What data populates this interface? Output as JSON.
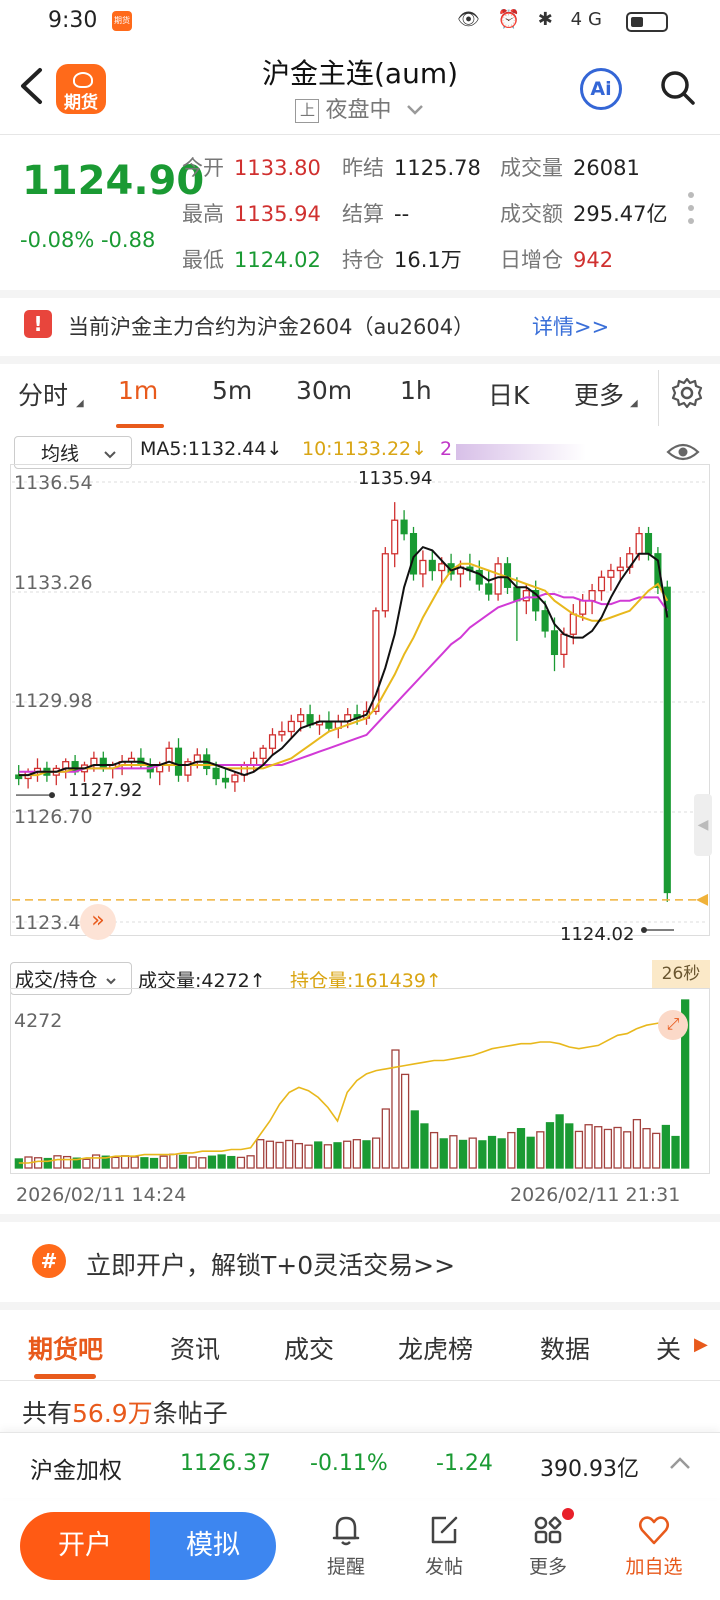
{
  "status": {
    "time": "9:30",
    "app_badge": "期货",
    "icons": "👁 ⏰ ✱ 4G"
  },
  "header": {
    "logo_text": "期货",
    "title": "沪金主连(aum)",
    "session_box": "上",
    "session_label": "夜盘中",
    "ai_label": "Ai"
  },
  "quote": {
    "last": "1124.90",
    "change_pct": "-0.08%",
    "change_abs": "-0.88",
    "open": {
      "label": "今开",
      "value": "1133.80"
    },
    "prev_close": {
      "label": "昨结",
      "value": "1125.78"
    },
    "volume": {
      "label": "成交量",
      "value": "26081"
    },
    "high": {
      "label": "最高",
      "value": "1135.94"
    },
    "settle": {
      "label": "结算",
      "value": "--"
    },
    "turnover": {
      "label": "成交额",
      "value": "295.47亿"
    },
    "low": {
      "label": "最低",
      "value": "1124.02"
    },
    "open_interest": {
      "label": "持仓",
      "value": "16.1万"
    },
    "oi_change": {
      "label": "日增仓",
      "value": "942"
    }
  },
  "notice": {
    "icon": "!",
    "text": "当前沪金主力合约为沪金2604（au2604）",
    "link": "详情>>"
  },
  "timeframes": [
    "分时",
    "1m",
    "5m",
    "30m",
    "1h",
    "日K",
    "更多"
  ],
  "indicators": {
    "select": "均线",
    "ma5": "MA5:1132.44↓",
    "ma10": "10:1133.22↓",
    "ma20": "2",
    "volume_select": "成交/持仓",
    "volume_text": "成交量:4272↑",
    "oi_text": "持仓量:161439↑",
    "countdown": "26秒"
  },
  "chart_data": {
    "type": "candlestick",
    "y_ticks": [
      "1136.54",
      "1133.26",
      "1129.98",
      "1126.70",
      "1123.42"
    ],
    "ylim": [
      1123.42,
      1136.54
    ],
    "annotations": {
      "high": "1135.94",
      "left_low": "1127.92",
      "right_low": "1124.02"
    },
    "candles": [
      [
        1127.8,
        1128.1,
        1127.5,
        1127.7
      ],
      [
        1127.7,
        1128.0,
        1127.4,
        1127.9
      ],
      [
        1127.9,
        1128.3,
        1127.6,
        1128.0
      ],
      [
        1128.0,
        1128.2,
        1127.6,
        1127.8
      ],
      [
        1127.8,
        1128.1,
        1127.5,
        1128.0
      ],
      [
        1128.0,
        1128.3,
        1127.7,
        1128.2
      ],
      [
        1128.2,
        1128.4,
        1127.8,
        1127.9
      ],
      [
        1127.9,
        1128.2,
        1127.6,
        1128.1
      ],
      [
        1128.1,
        1128.5,
        1127.9,
        1128.3
      ],
      [
        1128.3,
        1128.5,
        1127.9,
        1128.0
      ],
      [
        1128.0,
        1128.2,
        1127.7,
        1128.1
      ],
      [
        1128.1,
        1128.4,
        1127.8,
        1128.2
      ],
      [
        1128.2,
        1128.5,
        1128.0,
        1128.3
      ],
      [
        1128.3,
        1128.6,
        1128.0,
        1128.1
      ],
      [
        1128.1,
        1128.3,
        1127.7,
        1127.9
      ],
      [
        1127.9,
        1128.2,
        1127.5,
        1128.1
      ],
      [
        1128.1,
        1128.8,
        1127.9,
        1128.6
      ],
      [
        1128.6,
        1128.9,
        1127.6,
        1127.8
      ],
      [
        1127.8,
        1128.3,
        1127.6,
        1128.2
      ],
      [
        1128.2,
        1128.6,
        1128.0,
        1128.4
      ],
      [
        1128.4,
        1128.6,
        1127.8,
        1128.0
      ],
      [
        1128.0,
        1128.2,
        1127.5,
        1127.7
      ],
      [
        1127.7,
        1128.0,
        1127.4,
        1127.6
      ],
      [
        1127.6,
        1127.9,
        1127.3,
        1127.8
      ],
      [
        1127.8,
        1128.2,
        1127.6,
        1128.1
      ],
      [
        1128.1,
        1128.5,
        1127.9,
        1128.3
      ],
      [
        1128.3,
        1128.7,
        1128.1,
        1128.6
      ],
      [
        1128.6,
        1129.2,
        1128.4,
        1129.0
      ],
      [
        1129.0,
        1129.4,
        1128.8,
        1129.1
      ],
      [
        1129.1,
        1129.6,
        1128.9,
        1129.4
      ],
      [
        1129.4,
        1129.8,
        1129.1,
        1129.6
      ],
      [
        1129.6,
        1129.9,
        1129.2,
        1129.3
      ],
      [
        1129.3,
        1129.6,
        1129.0,
        1129.4
      ],
      [
        1129.4,
        1129.7,
        1129.1,
        1129.2
      ],
      [
        1129.2,
        1129.6,
        1128.9,
        1129.4
      ],
      [
        1129.4,
        1129.8,
        1129.2,
        1129.6
      ],
      [
        1129.6,
        1129.9,
        1129.3,
        1129.5
      ],
      [
        1129.5,
        1130.0,
        1129.3,
        1129.7
      ],
      [
        1129.7,
        1132.8,
        1129.6,
        1132.7
      ],
      [
        1132.7,
        1134.6,
        1132.5,
        1134.4
      ],
      [
        1134.4,
        1135.94,
        1134.0,
        1135.4
      ],
      [
        1135.4,
        1135.7,
        1134.8,
        1135.0
      ],
      [
        1135.0,
        1135.2,
        1133.6,
        1133.8
      ],
      [
        1133.8,
        1134.5,
        1133.4,
        1134.2
      ],
      [
        1134.2,
        1134.5,
        1133.6,
        1133.9
      ],
      [
        1133.9,
        1134.3,
        1133.5,
        1134.1
      ],
      [
        1134.1,
        1134.4,
        1133.6,
        1133.8
      ],
      [
        1133.8,
        1134.2,
        1133.4,
        1134.0
      ],
      [
        1134.0,
        1134.4,
        1133.6,
        1133.9
      ],
      [
        1133.9,
        1134.2,
        1133.3,
        1133.5
      ],
      [
        1133.5,
        1133.9,
        1133.0,
        1133.2
      ],
      [
        1133.2,
        1134.3,
        1133.0,
        1134.1
      ],
      [
        1134.1,
        1134.3,
        1133.2,
        1133.4
      ],
      [
        1133.4,
        1133.7,
        1131.8,
        1133.0
      ],
      [
        1133.0,
        1133.5,
        1132.6,
        1133.3
      ],
      [
        1133.3,
        1133.6,
        1132.4,
        1132.7
      ],
      [
        1132.7,
        1133.0,
        1131.9,
        1132.1
      ],
      [
        1132.1,
        1132.5,
        1130.9,
        1131.4
      ],
      [
        1131.4,
        1132.2,
        1131.0,
        1132.0
      ],
      [
        1132.0,
        1132.9,
        1131.7,
        1132.6
      ],
      [
        1132.6,
        1133.2,
        1132.4,
        1133.0
      ],
      [
        1133.0,
        1133.5,
        1132.6,
        1133.3
      ],
      [
        1133.3,
        1133.9,
        1133.0,
        1133.7
      ],
      [
        1133.7,
        1134.1,
        1133.3,
        1133.9
      ],
      [
        1133.9,
        1134.3,
        1133.6,
        1134.0
      ],
      [
        1134.0,
        1134.6,
        1133.8,
        1134.4
      ],
      [
        1134.4,
        1135.2,
        1134.2,
        1135.0
      ],
      [
        1135.0,
        1135.2,
        1134.2,
        1134.4
      ],
      [
        1134.4,
        1134.6,
        1133.2,
        1133.4
      ],
      [
        1133.4,
        1133.6,
        1124.02,
        1124.3
      ]
    ],
    "ma5": [
      1127.8,
      1127.8,
      1127.9,
      1127.9,
      1127.9,
      1128.0,
      1128.0,
      1128.0,
      1128.1,
      1128.1,
      1128.1,
      1128.2,
      1128.2,
      1128.2,
      1128.1,
      1128.1,
      1128.2,
      1128.1,
      1128.1,
      1128.2,
      1128.2,
      1128.1,
      1128.0,
      1127.9,
      1127.8,
      1127.9,
      1128.1,
      1128.4,
      1128.6,
      1128.9,
      1129.2,
      1129.3,
      1129.4,
      1129.4,
      1129.4,
      1129.4,
      1129.5,
      1129.6,
      1130.2,
      1131.0,
      1132.0,
      1133.4,
      1134.3,
      1134.6,
      1134.5,
      1134.2,
      1133.9,
      1134.0,
      1133.9,
      1133.8,
      1133.6,
      1133.7,
      1133.7,
      1133.4,
      1133.4,
      1133.2,
      1132.9,
      1132.3,
      1132.0,
      1131.9,
      1131.9,
      1132.1,
      1132.5,
      1133.1,
      1133.6,
      1134.0,
      1134.4,
      1134.4,
      1134.2,
      1132.5
    ],
    "ma10": [
      1127.8,
      1127.8,
      1127.8,
      1127.9,
      1127.9,
      1127.9,
      1128.0,
      1128.0,
      1128.0,
      1128.0,
      1128.0,
      1128.1,
      1128.1,
      1128.1,
      1128.1,
      1128.1,
      1128.1,
      1128.1,
      1128.1,
      1128.1,
      1128.1,
      1128.1,
      1128.0,
      1128.0,
      1128.0,
      1128.0,
      1128.0,
      1128.1,
      1128.2,
      1128.3,
      1128.5,
      1128.7,
      1128.9,
      1129.1,
      1129.2,
      1129.3,
      1129.4,
      1129.5,
      1129.8,
      1130.3,
      1130.8,
      1131.4,
      1131.9,
      1132.5,
      1133.0,
      1133.5,
      1133.9,
      1134.1,
      1134.1,
      1134.0,
      1133.9,
      1133.8,
      1133.7,
      1133.6,
      1133.5,
      1133.4,
      1133.3,
      1133.0,
      1132.8,
      1132.6,
      1132.5,
      1132.4,
      1132.4,
      1132.5,
      1132.6,
      1132.7,
      1133.0,
      1133.3,
      1133.5,
      1133.0
    ],
    "ma20": [
      1127.9,
      1127.9,
      1127.9,
      1127.9,
      1127.9,
      1127.9,
      1127.9,
      1128.0,
      1128.0,
      1128.0,
      1128.0,
      1128.0,
      1128.0,
      1128.0,
      1128.0,
      1128.1,
      1128.1,
      1128.1,
      1128.1,
      1128.1,
      1128.1,
      1128.1,
      1128.1,
      1128.1,
      1128.1,
      1128.1,
      1128.1,
      1128.1,
      1128.1,
      1128.2,
      1128.3,
      1128.4,
      1128.5,
      1128.6,
      1128.7,
      1128.8,
      1128.9,
      1129.0,
      1129.3,
      1129.6,
      1129.9,
      1130.2,
      1130.5,
      1130.8,
      1131.1,
      1131.4,
      1131.7,
      1131.9,
      1132.2,
      1132.4,
      1132.6,
      1132.8,
      1132.9,
      1133.0,
      1133.1,
      1133.1,
      1133.2,
      1133.2,
      1133.1,
      1133.1,
      1133.0,
      1133.0,
      1132.9,
      1132.9,
      1133.0,
      1133.0,
      1133.1,
      1133.1,
      1133.1,
      1132.7
    ],
    "volume_max": 4272,
    "volume_ytick": "4272",
    "volume": [
      230,
      280,
      260,
      240,
      310,
      290,
      250,
      220,
      330,
      300,
      270,
      310,
      280,
      260,
      240,
      300,
      350,
      320,
      280,
      260,
      300,
      330,
      290,
      270,
      310,
      720,
      680,
      650,
      700,
      620,
      580,
      660,
      590,
      640,
      680,
      720,
      690,
      760,
      1500,
      3000,
      2380,
      1450,
      1120,
      900,
      740,
      820,
      700,
      760,
      690,
      800,
      740,
      900,
      1000,
      780,
      920,
      1150,
      1350,
      1120,
      930,
      1100,
      1050,
      980,
      1030,
      920,
      1230,
      1000,
      880,
      1080,
      800,
      4272
    ],
    "oi": [
      0.03,
      0.03,
      0.04,
      0.04,
      0.05,
      0.05,
      0.05,
      0.06,
      0.06,
      0.06,
      0.07,
      0.07,
      0.07,
      0.08,
      0.08,
      0.08,
      0.08,
      0.09,
      0.09,
      0.1,
      0.1,
      0.1,
      0.11,
      0.11,
      0.12,
      0.2,
      0.28,
      0.38,
      0.45,
      0.48,
      0.46,
      0.42,
      0.36,
      0.28,
      0.45,
      0.52,
      0.56,
      0.58,
      0.59,
      0.6,
      0.61,
      0.62,
      0.63,
      0.64,
      0.64,
      0.65,
      0.66,
      0.67,
      0.69,
      0.71,
      0.72,
      0.73,
      0.74,
      0.74,
      0.75,
      0.75,
      0.74,
      0.72,
      0.71,
      0.72,
      0.73,
      0.76,
      0.79,
      0.8,
      0.83,
      0.85,
      0.86,
      0.87,
      0.88,
      0.9
    ],
    "x_start": "2026/02/11 14:24",
    "x_end": "2026/02/11 21:31"
  },
  "promo": {
    "icon": "#",
    "text": "立即开户，解锁T+0灵活交易>>"
  },
  "categories": [
    "期货吧",
    "资讯",
    "成交",
    "龙虎榜",
    "数据",
    "关"
  ],
  "posts": {
    "prefix": "共有",
    "count": "56.9万",
    "suffix": "条帖子"
  },
  "index_row": {
    "name": "沪金加权",
    "price": "1126.37",
    "pct": "-0.11%",
    "chg": "-1.24",
    "amount": "390.93亿"
  },
  "tabbar": {
    "open": "开户",
    "sim": "模拟",
    "remind": "提醒",
    "post": "发帖",
    "more": "更多",
    "watch": "加自选"
  },
  "colors": {
    "up": "#d0302f",
    "down": "#1a9a33",
    "accent": "#e85a1c",
    "ma5": "#111111",
    "ma10": "#e8b81c",
    "ma20": "#d13ad6"
  }
}
